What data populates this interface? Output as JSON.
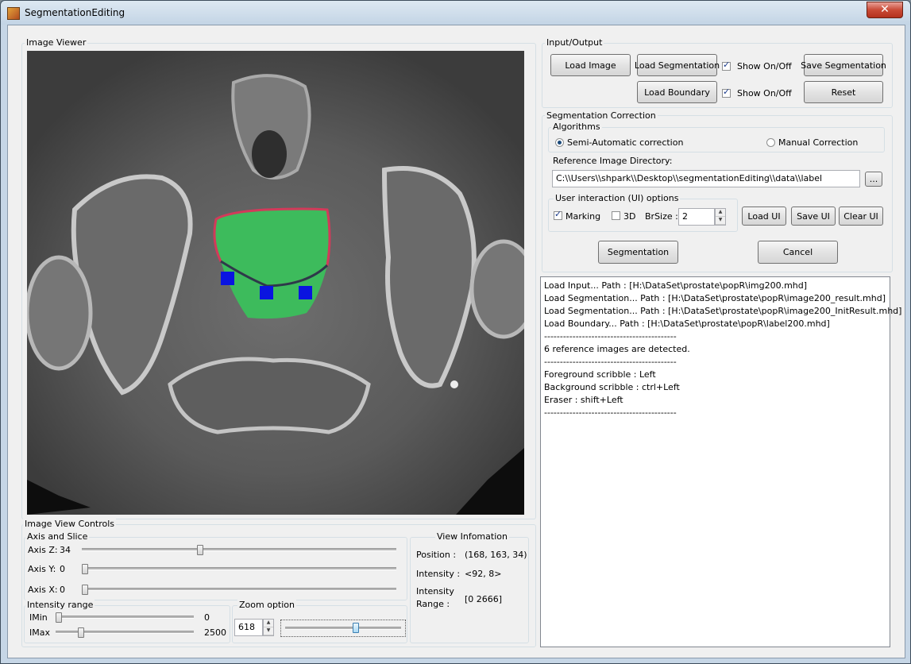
{
  "window": {
    "title": "SegmentationEditing",
    "close_symbol": "✕"
  },
  "image_viewer": {
    "label": "Image Viewer"
  },
  "io": {
    "label": "Input/Output",
    "load_image": "Load Image",
    "load_segmentation": "Load Segmentation",
    "show_seg": "Show On/Off",
    "save_segmentation": "Save Segmentation",
    "load_boundary": "Load Boundary",
    "show_boundary": "Show On/Off",
    "reset": "Reset"
  },
  "seg": {
    "label": "Segmentation Correction",
    "algorithms_label": "Algorithms",
    "semi_auto": "Semi-Automatic correction",
    "manual": "Manual Correction",
    "ref_dir_label": "Reference Image Directory:",
    "ref_dir_value": "C:\\\\Users\\\\shpark\\\\Desktop\\\\segmentationEditing\\\\data\\\\label",
    "browse": "...",
    "ui_options_label": "User interaction (UI) options",
    "marking": "Marking",
    "three_d": "3D",
    "brsize_label": "BrSize :",
    "brsize_value": "2",
    "load_ui": "Load UI",
    "save_ui": "Save UI",
    "clear_ui": "Clear UI",
    "segmentation": "Segmentation",
    "cancel": "Cancel"
  },
  "log": [
    "Load Input... Path : [H:\\DataSet\\prostate\\popR\\img200.mhd]",
    "Load Segmentation... Path : [H:\\DataSet\\prostate\\popR\\image200_result.mhd]",
    "Load Segmentation... Path : [H:\\DataSet\\prostate\\popR\\image200_InitResult.mhd]",
    "Load Boundary... Path : [H:\\DataSet\\prostate\\popR\\label200.mhd]",
    "------------------------------------------",
    "6 reference images are detected.",
    "------------------------------------------",
    "Foreground scribble : Left",
    "Background scribble : ctrl+Left",
    "Eraser : shift+Left",
    "------------------------------------------"
  ],
  "controls": {
    "label": "Image View Controls",
    "axis_label": "Axis and Slice",
    "axis_z_label": "Axis Z:",
    "axis_z_value": "34",
    "axis_y_label": "Axis Y:",
    "axis_y_value": "0",
    "axis_x_label": "Axis X:",
    "axis_x_value": "0",
    "intensity_label": "Intensity range",
    "imin_label": "IMin",
    "imin_value": "0",
    "imax_label": "IMax",
    "imax_value": "2500",
    "zoom_label": "Zoom option",
    "zoom_value": "618"
  },
  "info": {
    "label": "View Infomation",
    "position_label": "Position :",
    "position_value": "(168, 163, 34)",
    "intensity_label": "Intensity :",
    "intensity_value": "<92, 8>",
    "range_label_1": "Intensity",
    "range_label_2": "Range :",
    "range_value": "[0 2666]"
  },
  "colors": {
    "segmentation_fill": "#3dbb5c",
    "boundary": "#d23a5a",
    "scribble": "#0a14e0"
  }
}
